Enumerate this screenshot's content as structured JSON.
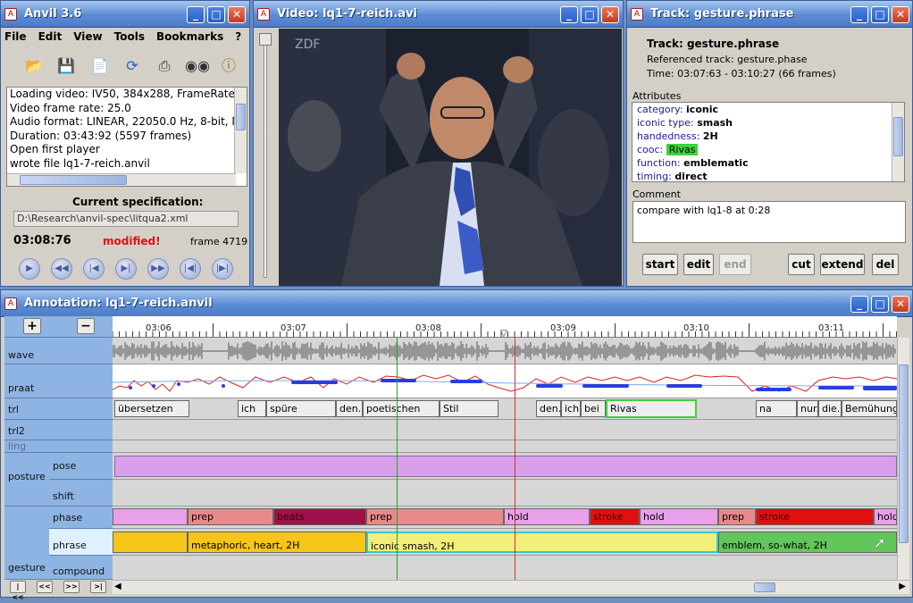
{
  "anvil": {
    "title": "Anvil 3.6",
    "menu": [
      "File",
      "Edit",
      "View",
      "Tools",
      "Bookmarks",
      "?"
    ],
    "tools": [
      "open-folder",
      "save-disk",
      "new-spec",
      "refresh",
      "print",
      "binoculars",
      "info"
    ],
    "log": [
      "Loading video: IV50, 384x288, FrameRate=25",
      "Video frame rate: 25.0",
      "Audio format: LINEAR, 22050.0 Hz, 8-bit, Mono",
      "Duration: 03:43:92 (5597 frames)",
      "Open first player",
      "wrote file lq1-7-reich.anvil"
    ],
    "spec_label": "Current specification:",
    "spec_path": "D:\\Research\\anvil-spec\\litqua2.xml",
    "time": "03:08:76",
    "modified": "modified!",
    "frame": "frame 4719",
    "player_buttons": [
      "play",
      "rewind",
      "step-back",
      "step-forward",
      "fast-forward",
      "jump-start",
      "jump-end"
    ]
  },
  "video": {
    "title": "Video: lq1-7-reich.avi",
    "channel_logo": "ZDF"
  },
  "track": {
    "title": "Track: gesture.phrase",
    "heading": "Track: gesture.phrase",
    "referenced": "Referenced track: gesture.phase",
    "time": "Time: 03:07:63 - 03:10:27 (66 frames)",
    "attributes_label": "Attributes",
    "attributes": [
      {
        "k": "category:",
        "v": "iconic"
      },
      {
        "k": "iconic type:",
        "v": "smash"
      },
      {
        "k": "handedness:",
        "v": "2H"
      },
      {
        "k": "cooc:",
        "v": "Rivas"
      },
      {
        "k": "function:",
        "v": "emblematic"
      },
      {
        "k": "timing:",
        "v": "direct"
      }
    ],
    "comment_label": "Comment",
    "comment": "compare with lq1-8 at 0:28",
    "buttons": [
      "start",
      "edit",
      "end",
      "cut",
      "extend",
      "del"
    ]
  },
  "annotation": {
    "title": "Annotation: lq1-7-reich.anvil",
    "zoom_in": "+",
    "zoom_out": "−",
    "ticks": [
      "03:06",
      "03:07",
      "03:08",
      "03:09",
      "03:10",
      "03:11"
    ],
    "groups": {
      "posture": "posture",
      "gesture": "gesture"
    },
    "tracks": {
      "wave": "wave",
      "praat": "praat",
      "trl": "trl",
      "trl2": "trl2",
      "ling": "ling",
      "pose": "pose",
      "shift": "shift",
      "phase": "phase",
      "phrase": "phrase",
      "compound": "compound"
    },
    "trl_words": [
      "übersetzen",
      "ich",
      "spüre",
      "den.",
      "poetischen",
      "Stil",
      "den.",
      "ich",
      "bei",
      "Rivas",
      "na",
      "nur.",
      "die.",
      "Bemühung"
    ],
    "phase": [
      "prep",
      "beats",
      "prep",
      "hold",
      "stroke",
      "hold",
      "prep",
      "stroke",
      "hold"
    ],
    "phrase": [
      "metaphoric, heart, 2H",
      "iconic  smash, 2H",
      "emblem, so-what, 2H"
    ],
    "nav": [
      "|<<",
      "<<",
      ">>",
      ">|"
    ]
  },
  "colors": {
    "titlebar": "#4d7cc6",
    "track_label": "#8eb4e3",
    "pose": "#d9a0ea",
    "phrase_yellow": "#f5c518",
    "phrase_light": "#f2ee7a",
    "phrase_green": "#63c65a",
    "selection": "#2fc8d8",
    "playhead": "#d03030",
    "cursor_green": "#2aa02a"
  }
}
